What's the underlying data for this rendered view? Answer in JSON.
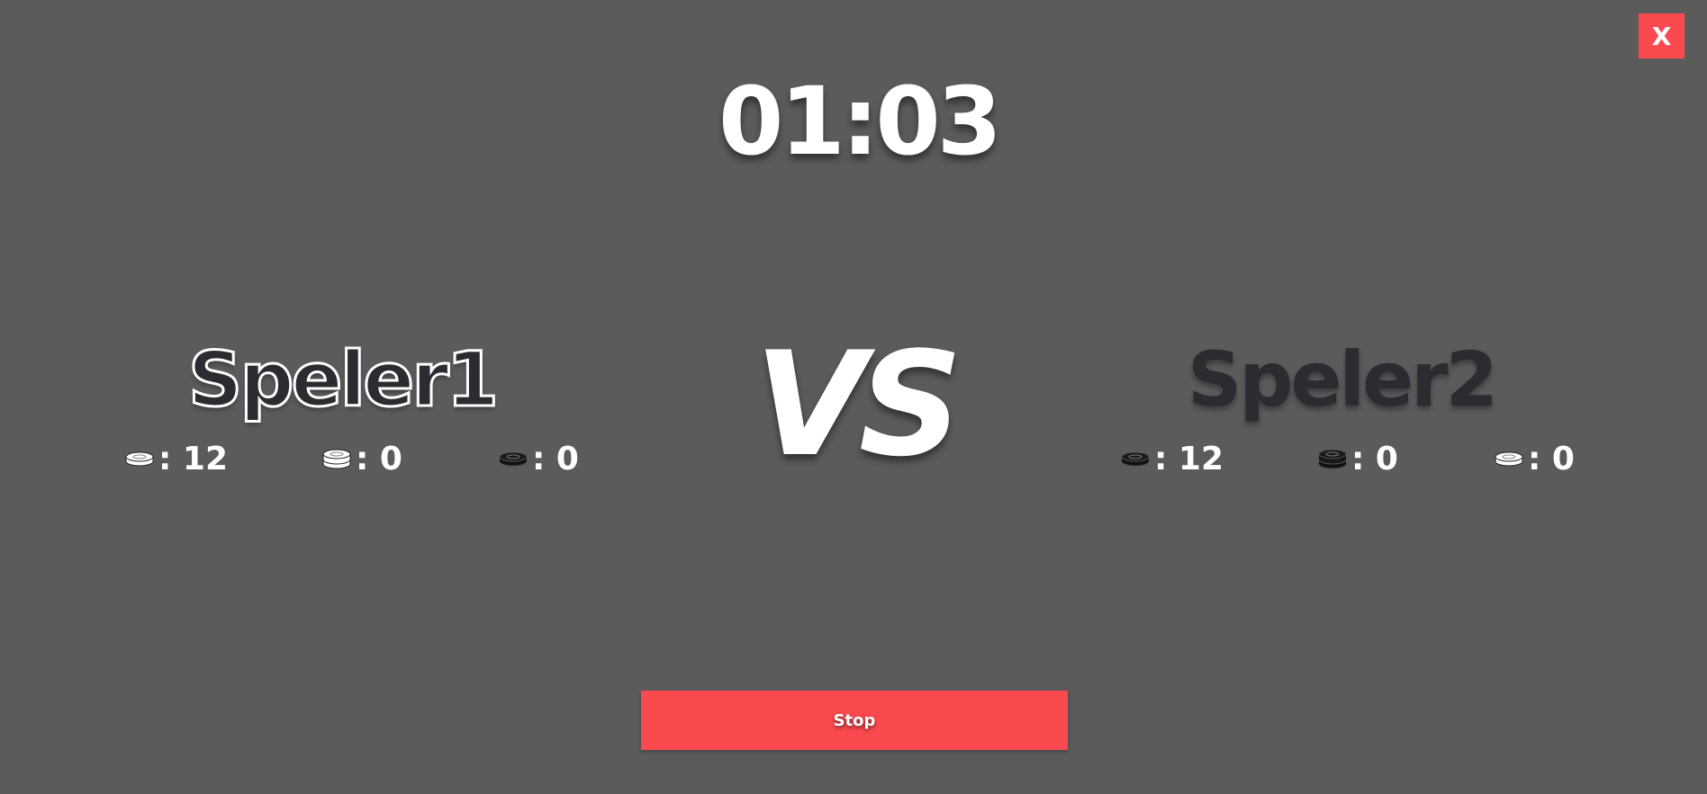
{
  "close_button": {
    "label": "X"
  },
  "timer": {
    "value": "01:03"
  },
  "vs_label": "VS",
  "player1": {
    "name": "Speler1",
    "stats": [
      {
        "icon": "white-piece-icon",
        "value": ": 12"
      },
      {
        "icon": "white-king-icon",
        "value": ": 0"
      },
      {
        "icon": "black-piece-icon",
        "value": ": 0"
      }
    ]
  },
  "player2": {
    "name": "Speler2",
    "stats": [
      {
        "icon": "black-piece-icon",
        "value": ": 12"
      },
      {
        "icon": "black-king-icon",
        "value": ": 0"
      },
      {
        "icon": "white-piece-icon",
        "value": ": 0"
      }
    ]
  },
  "stop_button": {
    "label": "Stop"
  },
  "colors": {
    "background": "#5b5b5b",
    "accent": "#fb4a4f",
    "text": "#ffffff",
    "dark_name": "#2b2c31"
  }
}
